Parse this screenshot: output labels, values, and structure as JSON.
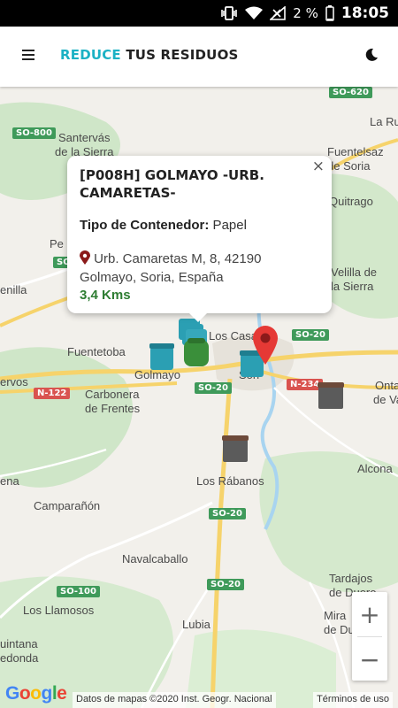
{
  "status_bar": {
    "battery_text": "2 %",
    "time": "18:05"
  },
  "app_bar": {
    "title_accent": "REDUCE",
    "title_rest": " TUS RESIDUOS"
  },
  "map": {
    "places": [
      "Santervás",
      "de la Sierra",
      "Fuentelsaz",
      "de Soria",
      "Quitrago",
      "Pe",
      "Velilla de",
      "la Sierra",
      "enilla",
      "Fuentetoba",
      "Golmayo",
      "Sori",
      "Los Casa",
      "Carbonera",
      "de Frentes",
      "ervos",
      "Onta",
      "de Va",
      "La Ru",
      "Alcona",
      "ena",
      "Los Rábanos",
      "Camparañón",
      "Navalcaballo",
      "Tardajos",
      "de Duero",
      "Los Llamosos",
      "Mira",
      "de Du",
      "Lubia",
      "uintana",
      "edonda"
    ],
    "roads": [
      "SO-800",
      "SO-620",
      "SO-20",
      "N-122",
      "SO-20",
      "N-234",
      "SO-20",
      "SO-100",
      "SO-20",
      "SO-615"
    ]
  },
  "popup": {
    "close": "×",
    "title": "[P008H] GOLMAYO -URB. CAMARETAS-",
    "type_label": "Tipo de Contenedor:",
    "type_value": " Papel",
    "address": "Urb. Camaretas M, 8, 42190 Golmayo, Soria, España",
    "distance": "3,4 Kms"
  },
  "zoom": {
    "in": "+",
    "out": "−"
  },
  "attribution": {
    "google": "Google",
    "data": "Datos de mapas ©2020 Inst. Geogr. Nacional",
    "terms": "Términos de uso"
  },
  "colors": {
    "accent": "#1bb1c4",
    "pin": "#e53935",
    "distance": "#2e7d32",
    "bin_green": "#3a8f3a",
    "bin_blue": "#2b9fb3",
    "bin_dark": "#5b5b5b"
  },
  "icons": {
    "menu": "menu-icon",
    "theme": "moon-icon",
    "pin": "map-pin-icon",
    "close": "close-icon"
  }
}
